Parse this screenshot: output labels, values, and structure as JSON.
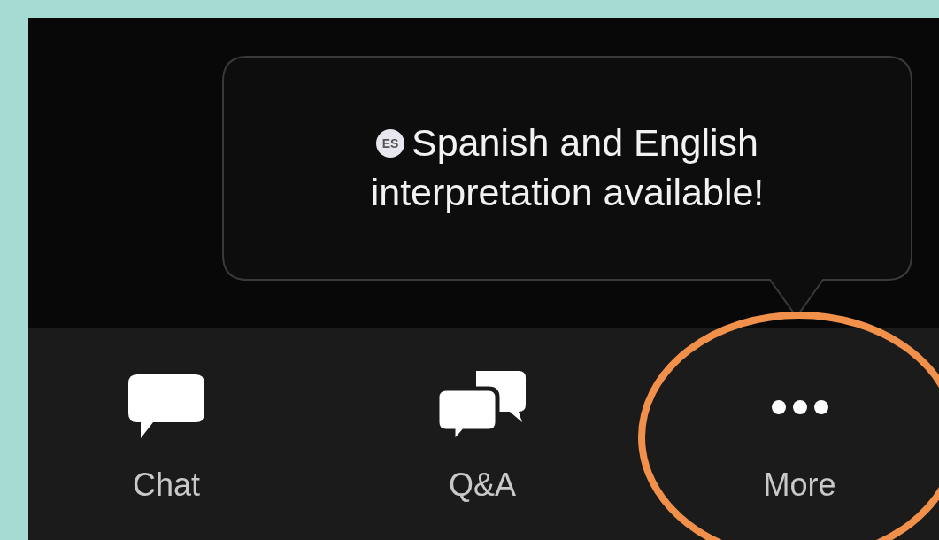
{
  "tooltip": {
    "badge": "ES",
    "lines": [
      "Spanish and English",
      "interpretation available!"
    ]
  },
  "toolbar": [
    {
      "label": "Chat",
      "kind": "chat",
      "highlighted": false
    },
    {
      "label": "Q&A",
      "kind": "qa",
      "highlighted": false
    },
    {
      "label": "More",
      "kind": "more",
      "highlighted": true
    }
  ]
}
